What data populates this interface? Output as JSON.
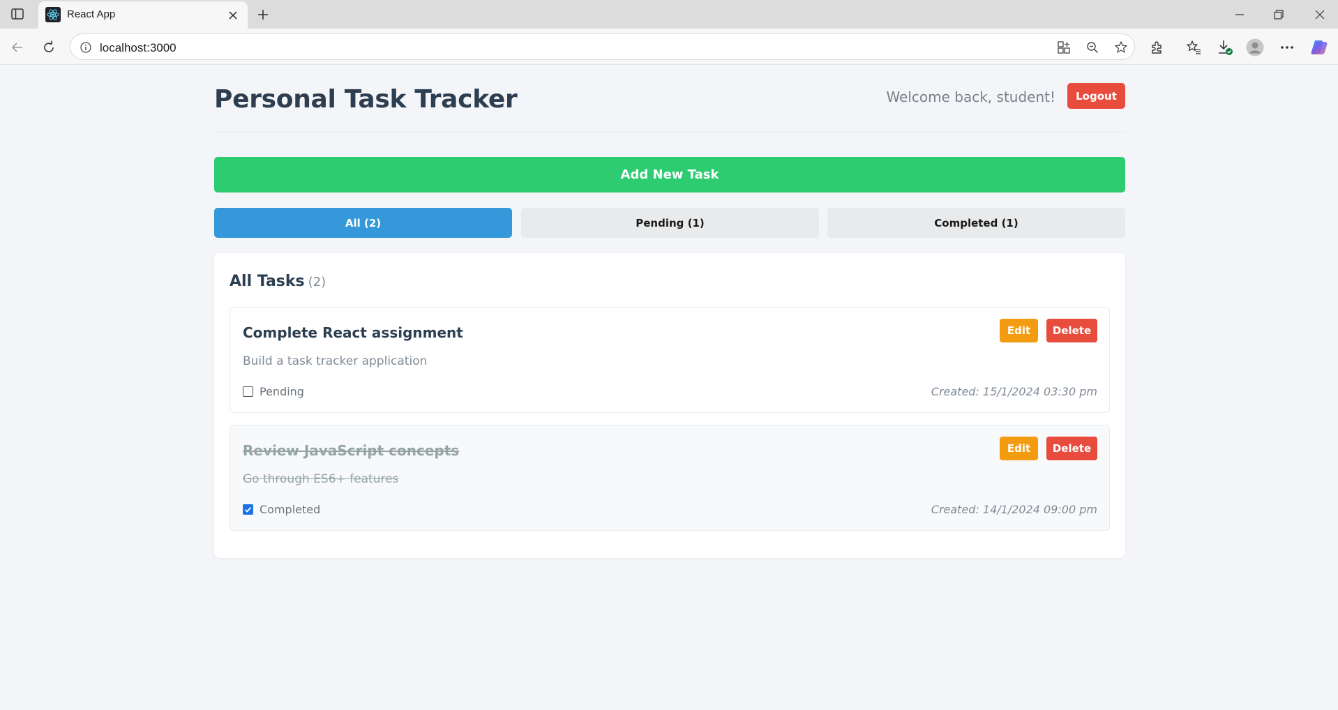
{
  "browser": {
    "tab_title": "React App",
    "url": "localhost:3000",
    "icons": [
      "sidebar-icon",
      "react-favicon",
      "close-icon",
      "plus-icon",
      "minimize-icon",
      "restore-icon",
      "back-icon",
      "refresh-icon",
      "info-icon",
      "app-grid-icon",
      "zoom-out-icon",
      "star-icon",
      "extensions-icon",
      "favorites-icon",
      "downloads-icon",
      "profile-icon",
      "more-icon",
      "copilot-icon"
    ]
  },
  "header": {
    "title": "Personal Task Tracker",
    "welcome": "Welcome back, student!",
    "logout_label": "Logout"
  },
  "actions": {
    "add_task_label": "Add New Task"
  },
  "filters": [
    {
      "label": "All (2)",
      "active": true
    },
    {
      "label": "Pending (1)",
      "active": false
    },
    {
      "label": "Completed (1)",
      "active": false
    }
  ],
  "panel": {
    "title": "All Tasks",
    "count": "(2)"
  },
  "tasks": [
    {
      "title": "Complete React assignment",
      "description": "Build a task tracker application",
      "status": "Pending",
      "completed": false,
      "created": "Created: 15/1/2024 03:30 pm",
      "edit_label": "Edit",
      "delete_label": "Delete"
    },
    {
      "title": "Review JavaScript concepts",
      "description": "Go through ES6+ features",
      "status": "Completed",
      "completed": true,
      "created": "Created: 14/1/2024 09:00 pm",
      "edit_label": "Edit",
      "delete_label": "Delete"
    }
  ],
  "colors": {
    "primary": "#3498db",
    "success": "#2ecc71",
    "danger": "#e74c3c",
    "warning": "#f39c12",
    "heading": "#2c3e50"
  }
}
